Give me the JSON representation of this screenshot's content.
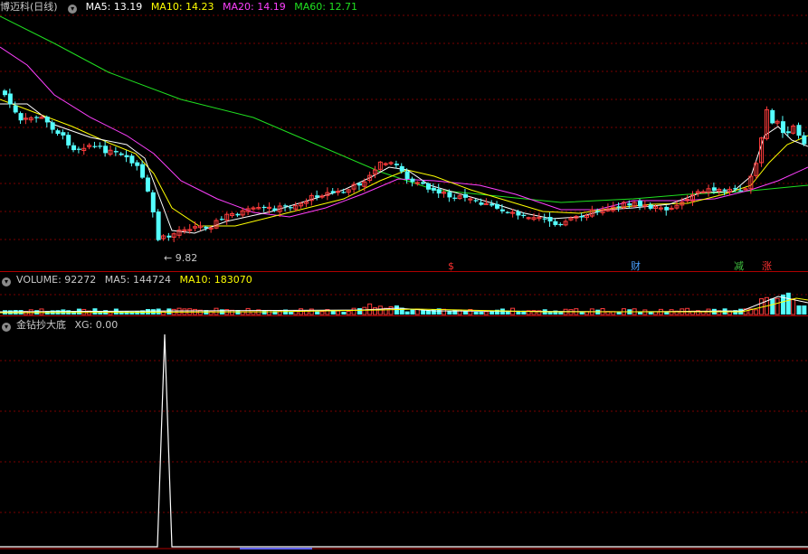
{
  "main_legend": {
    "title": "博迈科",
    "period": "(日线)",
    "ma5": "MA5: 13.19",
    "ma10": "MA10: 14.23",
    "ma20": "MA20: 14.19",
    "ma60": "MA60: 12.71"
  },
  "volume_legend": {
    "label": "VOLUME: 92272",
    "ma5": "MA5: 144724",
    "ma10": "MA10: 183070"
  },
  "indicator_legend": {
    "name": "金钻抄大底",
    "xg": "XG: 0.00"
  },
  "low_marker": "9.82",
  "event_tags": [
    {
      "text": "$",
      "color": "#ff3030"
    },
    {
      "text": "财",
      "color": "#4aa0ff"
    },
    {
      "text": "减",
      "color": "#40c040"
    },
    {
      "text": "涨",
      "color": "#ff3030"
    }
  ],
  "colors": {
    "up": "#ff3c3c",
    "down": "#54ffff",
    "ma5": "#ffffff",
    "ma10": "#ffff00",
    "ma20": "#ff40ff",
    "ma60": "#20e020",
    "grid": "#7a0000",
    "signal": "#ffffff"
  },
  "chart_data": {
    "type": "candlestick",
    "title": "博迈科 (日线)",
    "low_annotation": 9.82,
    "last_values": {
      "MA5": 13.19,
      "MA10": 14.23,
      "MA20": 14.19,
      "MA60": 12.71,
      "VOLUME": 92272,
      "VOL_MA5": 144724,
      "VOL_MA10": 183070,
      "XG": 0.0
    },
    "indicator_signal_index": 44
  }
}
